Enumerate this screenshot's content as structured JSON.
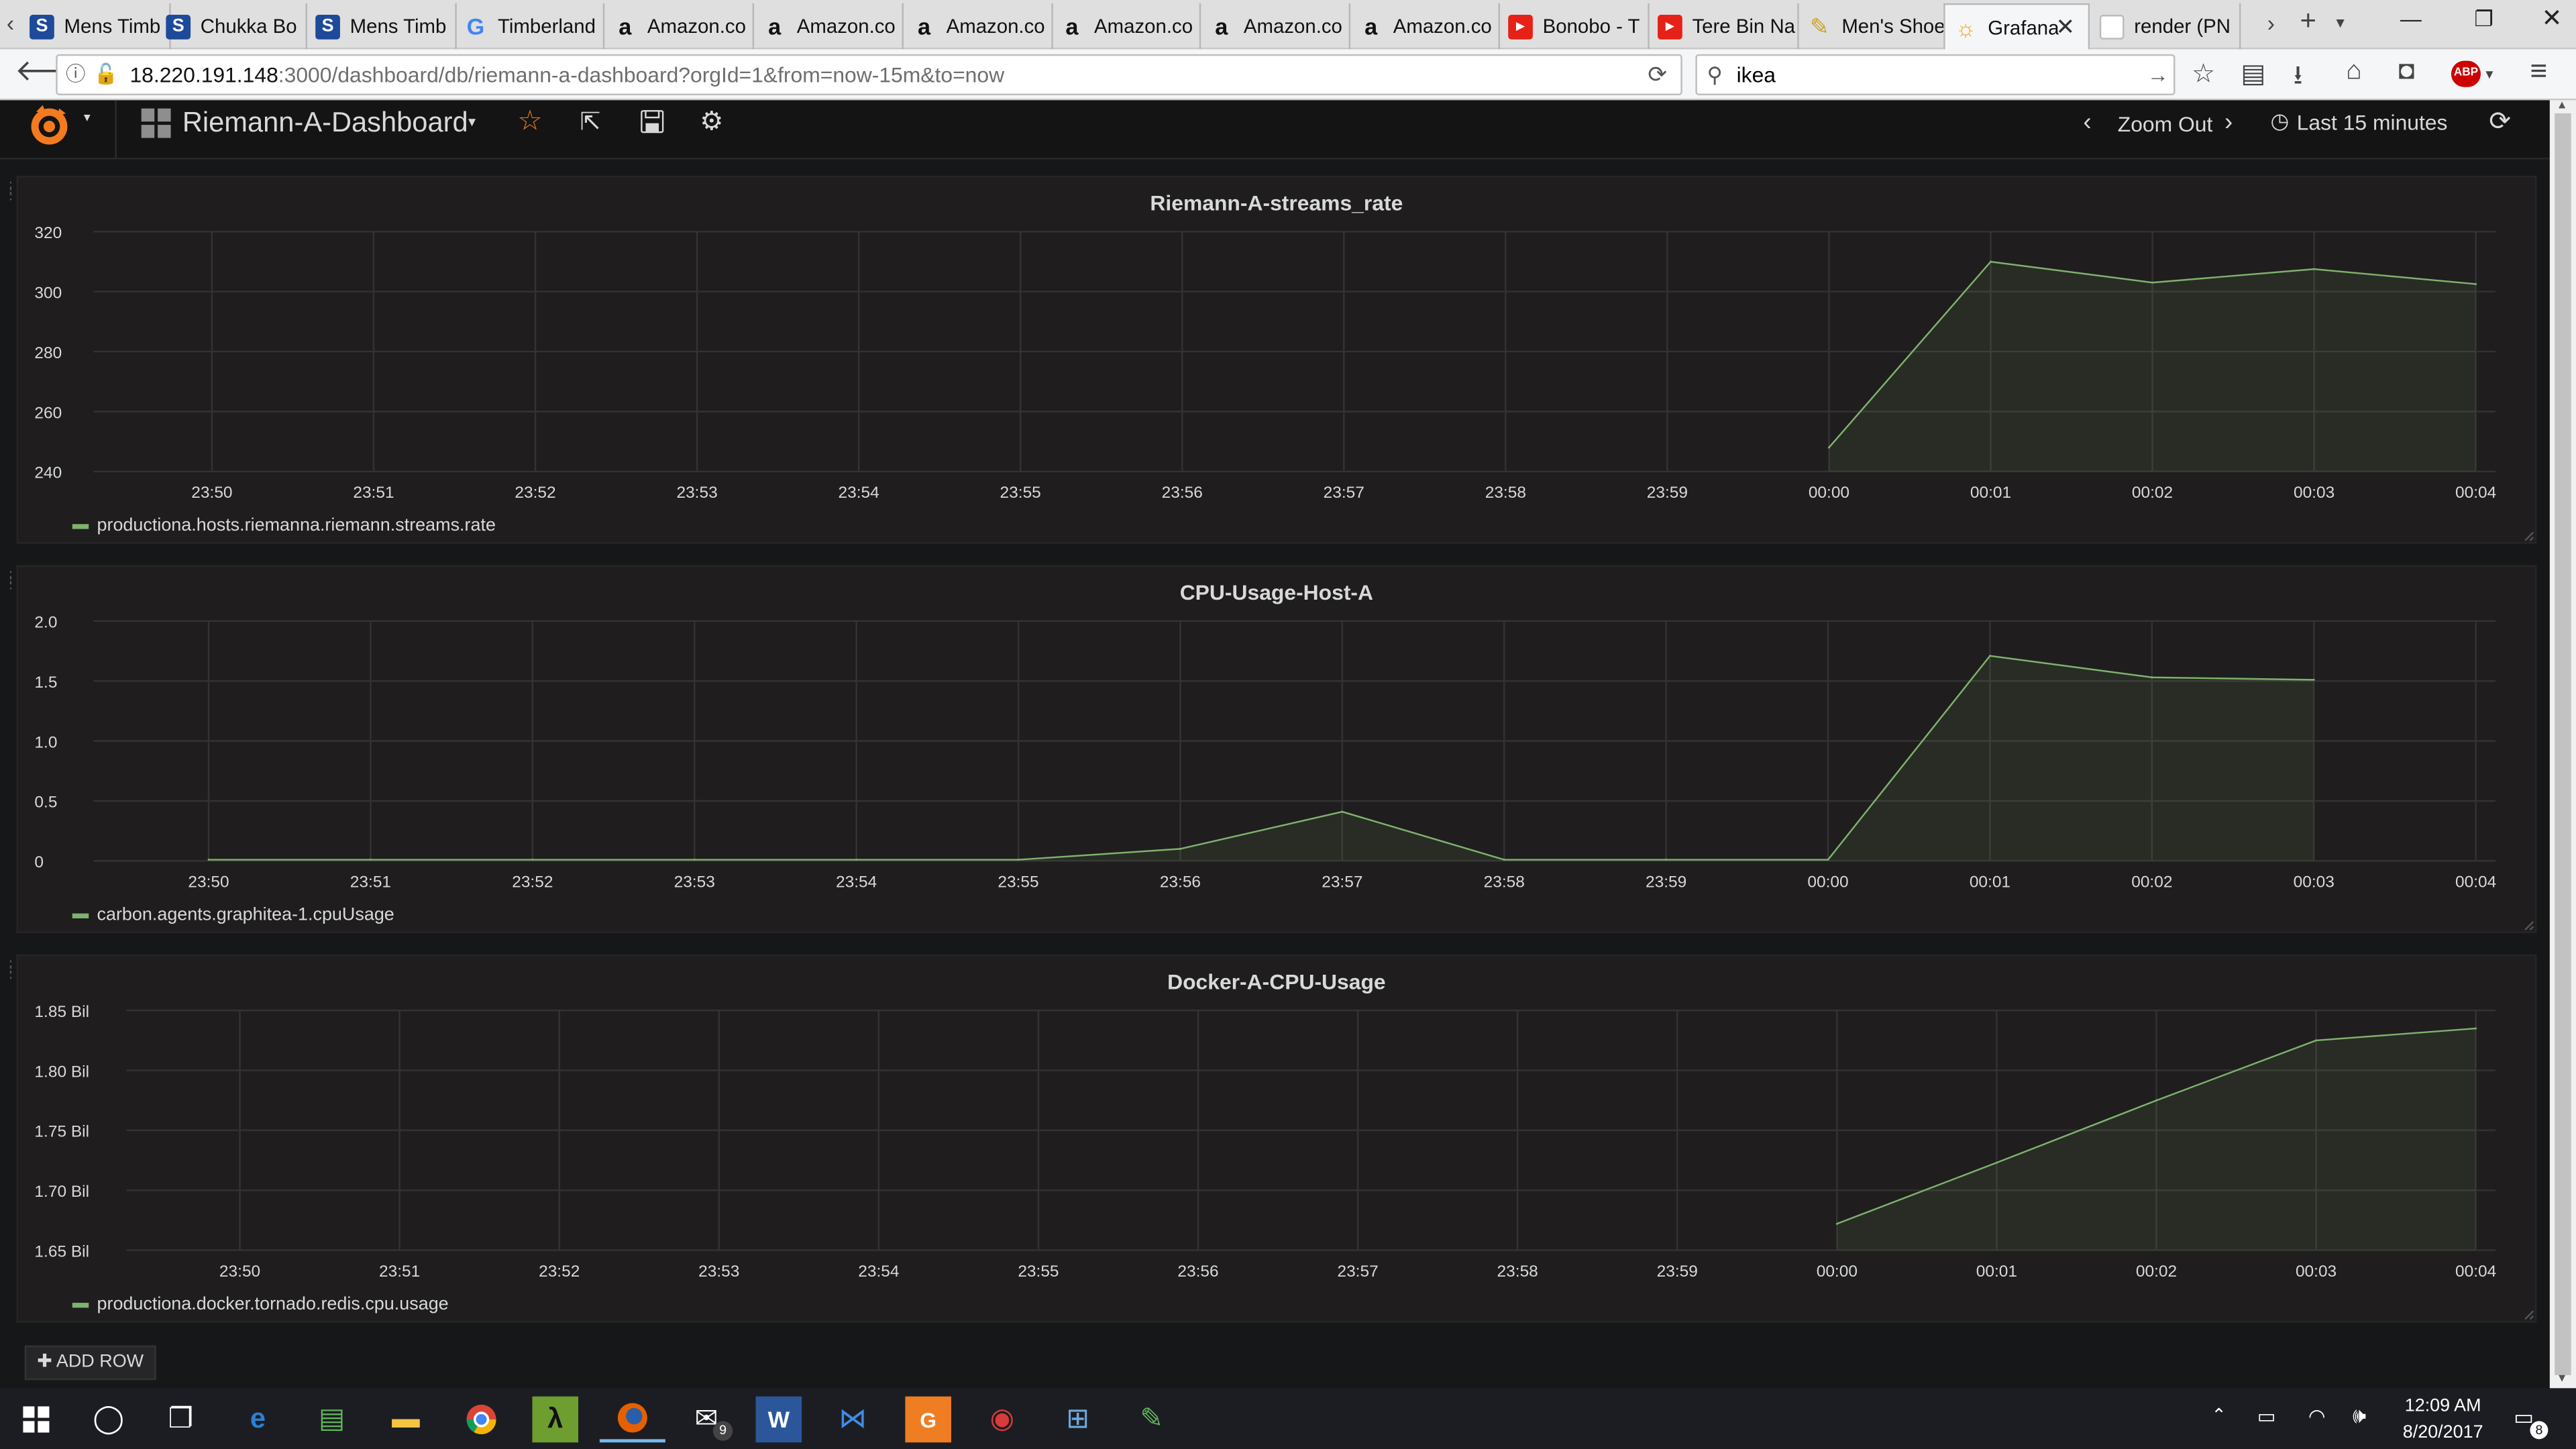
{
  "browser": {
    "tabs": [
      {
        "label": "Mens Timb",
        "icon": "s-doc-icon",
        "color": "#1e4a9a",
        "glyph": "S"
      },
      {
        "label": "Chukka Bo",
        "icon": "s-doc-icon",
        "color": "#1e4a9a",
        "glyph": "S"
      },
      {
        "label": "Mens Timb",
        "icon": "s-doc-icon",
        "color": "#1e4a9a",
        "glyph": "S"
      },
      {
        "label": "Timberland",
        "icon": "google-icon",
        "color": "#4285f4",
        "glyph": "G"
      },
      {
        "label": "Amazon.co",
        "icon": "amazon-icon",
        "color": "#111111",
        "glyph": "a"
      },
      {
        "label": "Amazon.co",
        "icon": "amazon-icon",
        "color": "#111111",
        "glyph": "a"
      },
      {
        "label": "Amazon.co",
        "icon": "amazon-icon",
        "color": "#111111",
        "glyph": "a"
      },
      {
        "label": "Amazon.co",
        "icon": "amazon-icon",
        "color": "#111111",
        "glyph": "a"
      },
      {
        "label": "Amazon.co",
        "icon": "amazon-icon",
        "color": "#111111",
        "glyph": "a"
      },
      {
        "label": "Amazon.co",
        "icon": "amazon-icon",
        "color": "#111111",
        "glyph": "a"
      },
      {
        "label": "Bonobo - T",
        "icon": "youtube-icon",
        "color": "#e62117",
        "glyph": "▶"
      },
      {
        "label": "Tere Bin Na",
        "icon": "youtube-icon",
        "color": "#e62117",
        "glyph": "▶"
      },
      {
        "label": "Men's Shoe",
        "icon": "store-icon",
        "color": "#c9a227",
        "glyph": "✎"
      },
      {
        "label": "Grafana",
        "icon": "grafana-icon",
        "color": "#f6a623",
        "glyph": "☼",
        "active": true
      },
      {
        "label": "render (PN",
        "icon": "page-icon",
        "color": "#ffffff",
        "glyph": ""
      }
    ],
    "url_host": "18.220.191.148",
    "url_rest": ":3000/dashboard/db/riemann-a-dashboard?orgId=1&from=now-15m&to=now",
    "search_value": "ikea",
    "abp_label": "ABP"
  },
  "grafana": {
    "dashboard_title": "Riemann-A-Dashboard",
    "zoom_out_label": "Zoom Out",
    "time_range_label": "Last 15 minutes",
    "add_row_label": "ADD ROW"
  },
  "colors": {
    "series": "#7eb26d",
    "panel_bg": "#1f1d1d",
    "page_bg": "#161719"
  },
  "chart_data": [
    {
      "type": "area",
      "title": "Riemann-A-streams_rate",
      "x": [
        "23:50",
        "23:51",
        "23:52",
        "23:53",
        "23:54",
        "23:55",
        "23:56",
        "23:57",
        "23:58",
        "23:59",
        "00:00",
        "00:01",
        "00:02",
        "00:03",
        "00:04"
      ],
      "yticks": [
        "240",
        "260",
        "280",
        "300",
        "320"
      ],
      "ylim": [
        240,
        320
      ],
      "series": [
        {
          "name": "productiona.hosts.riemanna.riemann.streams.rate",
          "x": [
            "00:00",
            "00:01",
            "00:02",
            "00:03",
            "00:04"
          ],
          "values": [
            248,
            310,
            303,
            307.5,
            302.5
          ]
        }
      ],
      "grid": true,
      "legend": "bottom-left"
    },
    {
      "type": "area",
      "title": "CPU-Usage-Host-A",
      "x": [
        "23:50",
        "23:51",
        "23:52",
        "23:53",
        "23:54",
        "23:55",
        "23:56",
        "23:57",
        "23:58",
        "23:59",
        "00:00",
        "00:01",
        "00:02",
        "00:03",
        "00:04"
      ],
      "yticks": [
        "0",
        "0.5",
        "1.0",
        "1.5",
        "2.0"
      ],
      "ylim": [
        0,
        2.0
      ],
      "series": [
        {
          "name": "carbon.agents.graphitea-1.cpuUsage",
          "x": [
            "23:50",
            "23:51",
            "23:52",
            "23:53",
            "23:54",
            "23:55",
            "23:56",
            "23:57",
            "23:58",
            "23:59",
            "00:00",
            "00:01",
            "00:02",
            "00:03"
          ],
          "values": [
            0.01,
            0.01,
            0.01,
            0.01,
            0.01,
            0.01,
            0.1,
            0.41,
            0.01,
            0.01,
            0.01,
            1.71,
            1.53,
            1.51
          ]
        }
      ],
      "grid": true,
      "legend": "bottom-left"
    },
    {
      "type": "area",
      "title": "Docker-A-CPU-Usage",
      "x": [
        "23:50",
        "23:51",
        "23:52",
        "23:53",
        "23:54",
        "23:55",
        "23:56",
        "23:57",
        "23:58",
        "23:59",
        "00:00",
        "00:01",
        "00:02",
        "00:03",
        "00:04"
      ],
      "yticks": [
        "1.65 Bil",
        "1.70 Bil",
        "1.75 Bil",
        "1.80 Bil",
        "1.85 Bil"
      ],
      "ylim": [
        1.65,
        1.85
      ],
      "series": [
        {
          "name": "productiona.docker.tornado.redis.cpu.usage",
          "x": [
            "00:00",
            "00:01",
            "00:02",
            "00:03",
            "00:04"
          ],
          "values": [
            1.672,
            1.723,
            1.775,
            1.825,
            1.835
          ]
        }
      ],
      "grid": true,
      "legend": "bottom-left"
    }
  ],
  "taskbar": {
    "time": "12:09 AM",
    "date": "8/20/2017",
    "mail_badge": "9",
    "notification_count": "8"
  }
}
